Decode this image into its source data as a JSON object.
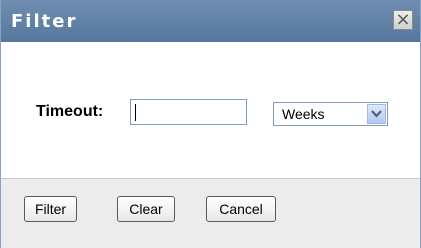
{
  "dialog": {
    "title": "Filter",
    "close_glyph": "×",
    "close_icon": "close-icon"
  },
  "form": {
    "timeout_label": "Timeout:",
    "timeout_value": "",
    "unit_selected": "Weeks",
    "dropdown_icon": "chevron-down-icon"
  },
  "footer": {
    "filter_label": "Filter",
    "clear_label": "Clear",
    "cancel_label": "Cancel"
  },
  "colors": {
    "titlebar": "#6f8eb1",
    "title_text": "#ffffff",
    "footer_bg": "#ececec",
    "input_border": "#7f9db9",
    "dropdown_button": "#c7d6f4"
  }
}
